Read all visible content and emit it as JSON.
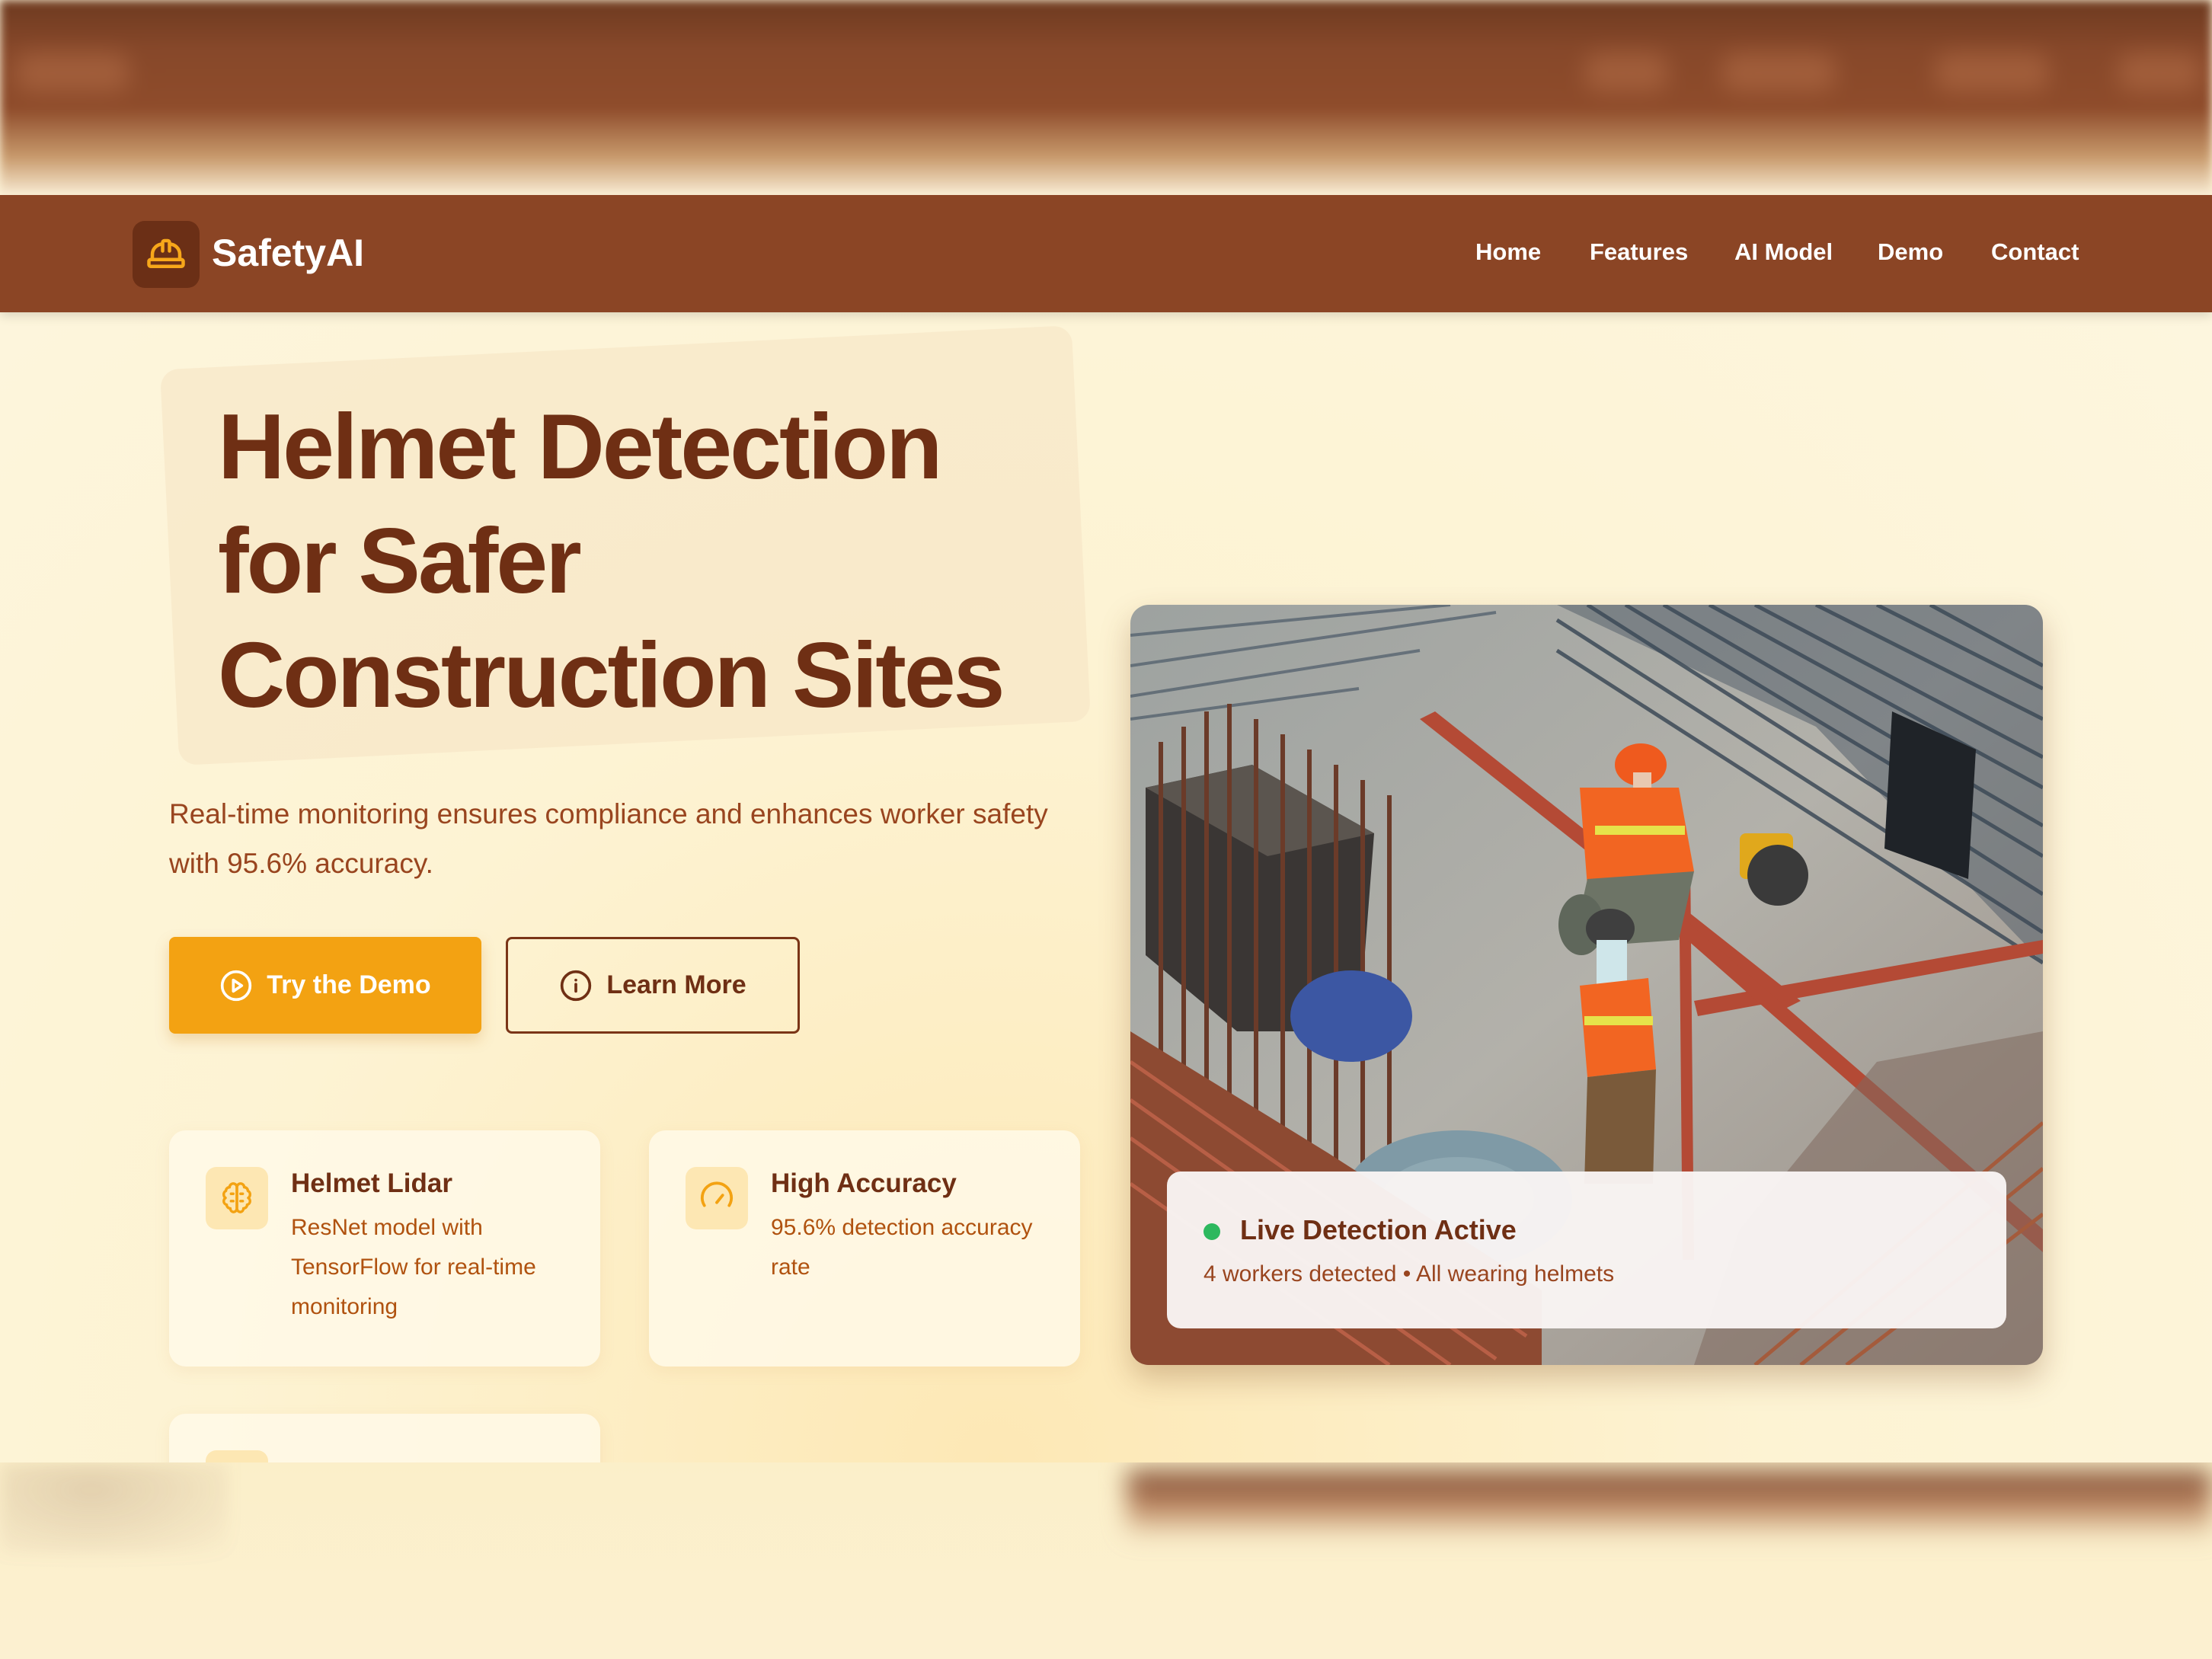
{
  "brand": {
    "name": "SafetyAI",
    "logo_icon": "hard-hat-icon"
  },
  "nav": {
    "items": [
      "Home",
      "Features",
      "AI Model",
      "Demo",
      "Contact"
    ]
  },
  "hero": {
    "headline_lines": [
      "Helmet Detection",
      "for Safer",
      "Construction Sites"
    ],
    "subtitle": "Real-time monitoring ensures compliance and enhances worker safety with 95.6% accuracy.",
    "primary_button": {
      "label": "Try the Demo",
      "icon": "play-circle-icon"
    },
    "secondary_button": {
      "label": "Learn More",
      "icon": "info-circle-icon"
    }
  },
  "features": [
    {
      "icon": "brain-icon",
      "title": "Helmet Lidar",
      "description": "ResNet model with TensorFlow for real-time monitoring"
    },
    {
      "icon": "gauge-icon",
      "title": "High Accuracy",
      "description": "95.6% detection accuracy rate"
    }
  ],
  "live_detection": {
    "title": "Live Detection Active",
    "subtitle": "4 workers detected • All wearing helmets",
    "status_color": "#2db85e"
  },
  "colors": {
    "brown": "#8b4525",
    "dark_brown": "#6f2f14",
    "accent": "#f3a212",
    "cream": "#fdf5dc"
  }
}
